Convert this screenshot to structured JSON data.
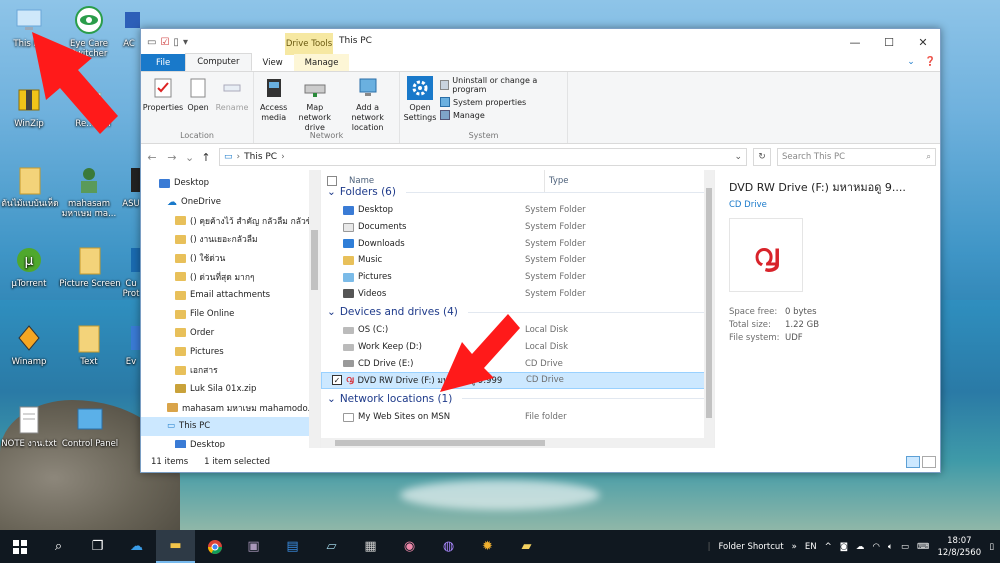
{
  "desktop": {
    "icons": [
      {
        "label": "This PC"
      },
      {
        "label": "Eye Care Switcher"
      },
      {
        "label": "WinZip"
      },
      {
        "label": "Re... Bin"
      },
      {
        "label": "ต้นไม้แบบ้นเห็ด"
      },
      {
        "label": "mahasam มหาเษม ma..."
      },
      {
        "label": "µTorrent"
      },
      {
        "label": "Picture Screen"
      },
      {
        "label": "Winamp"
      },
      {
        "label": "Text"
      },
      {
        "label": "NOTE งาน.txt"
      },
      {
        "label": "Control Panel"
      },
      {
        "label": "ASU"
      },
      {
        "label": "Cu Prot"
      },
      {
        "label": "Ev"
      },
      {
        "label": "AC"
      }
    ]
  },
  "window": {
    "title": "This PC",
    "context_tab": "Drive Tools",
    "tabs": [
      "File",
      "Computer",
      "View",
      "Manage"
    ],
    "ribbon": {
      "location": {
        "name": "Location",
        "buttons": [
          "Properties",
          "Open",
          "Rename"
        ]
      },
      "network": {
        "name": "Network",
        "buttons": [
          "Access media",
          "Map network drive",
          "Add a network location"
        ]
      },
      "system": {
        "name": "System",
        "open_settings": "Open Settings",
        "items": [
          "Uninstall or change a program",
          "System properties",
          "Manage"
        ]
      }
    },
    "address": {
      "path": "This PC",
      "search_placeholder": "Search This PC"
    },
    "nav": [
      {
        "label": "Desktop",
        "indent": 0
      },
      {
        "label": "OneDrive",
        "indent": 1
      },
      {
        "label": "() คุยค้างไว้ สำคัญ กลัวลืม กลัวข้าม",
        "indent": 2
      },
      {
        "label": "() งานเยอะกลัวลืม",
        "indent": 2
      },
      {
        "label": "() ใช้ด่วน",
        "indent": 2
      },
      {
        "label": "() ด่วนที่สุด มากๆ",
        "indent": 2
      },
      {
        "label": "Email attachments",
        "indent": 2
      },
      {
        "label": "File Online",
        "indent": 2
      },
      {
        "label": "Order",
        "indent": 2
      },
      {
        "label": "Pictures",
        "indent": 2
      },
      {
        "label": "เอกสาร",
        "indent": 2
      },
      {
        "label": "Luk Sila 01x.zip",
        "indent": 2
      },
      {
        "label": "mahasam มหาเษม mahamodo...",
        "indent": 1
      },
      {
        "label": "This PC",
        "indent": 1,
        "selected": true
      },
      {
        "label": "Desktop",
        "indent": 2
      }
    ],
    "columns": {
      "name": "Name",
      "type": "Type"
    },
    "sections": [
      {
        "title": "Folders (6)",
        "items": [
          {
            "name": "Desktop",
            "type": "System Folder"
          },
          {
            "name": "Documents",
            "type": "System Folder"
          },
          {
            "name": "Downloads",
            "type": "System Folder"
          },
          {
            "name": "Music",
            "type": "System Folder"
          },
          {
            "name": "Pictures",
            "type": "System Folder"
          },
          {
            "name": "Videos",
            "type": "System Folder"
          }
        ]
      },
      {
        "title": "Devices and drives (4)",
        "items": [
          {
            "name": "OS (C:)",
            "type": "Local Disk"
          },
          {
            "name": "Work Keep (D:)",
            "type": "Local Disk"
          },
          {
            "name": "CD Drive (E:)",
            "type": "CD Drive"
          },
          {
            "name": "DVD RW Drive (F:) มหาหมอดู 9.999",
            "type": "CD Drive",
            "selected": true
          }
        ]
      },
      {
        "title": "Network locations (1)",
        "items": [
          {
            "name": "My Web Sites on MSN",
            "type": "File folder"
          }
        ]
      }
    ],
    "details": {
      "title": "DVD RW Drive (F:) มหาหมอดู 9....",
      "subtitle": "CD Drive",
      "space_free_label": "Space free:",
      "space_free": "0 bytes",
      "total_size_label": "Total size:",
      "total_size": "1.22 GB",
      "fs_label": "File system:",
      "fs": "UDF",
      "logo_color": "#d8232a"
    },
    "status": {
      "count": "11 items",
      "selected": "1 item selected"
    }
  },
  "taskbar": {
    "tray_label": "Folder Shortcut",
    "lang": "EN",
    "time": "18:07",
    "date": "12/8/2560"
  },
  "colors": {
    "accent": "#1979ca",
    "annotation_arrow": "#ff1a1a"
  }
}
